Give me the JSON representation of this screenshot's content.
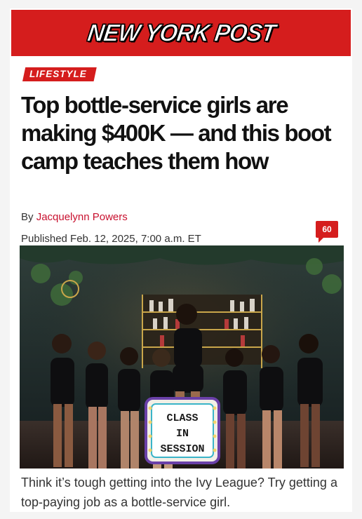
{
  "masthead": {
    "logo_text": "NEW YORK POST"
  },
  "article": {
    "section": "LIFESTYLE",
    "headline": "Top bottle-service girls are making $400K — and this boot camp teaches them how",
    "byline_prefix": "By ",
    "author": "Jacquelynn Powers",
    "published": "Published Feb. 12, 2025, 7:00 a.m. ET",
    "comment_count": "60",
    "photo": {
      "sign_lines": [
        "CLASS",
        "IN",
        "SESSION"
      ]
    },
    "caption": "Think it’s tough getting into the Ivy League? Try getting a top-paying job as a bottle-service girl."
  },
  "colors": {
    "brand_red": "#d51d1d",
    "link_red": "#c8102e"
  }
}
